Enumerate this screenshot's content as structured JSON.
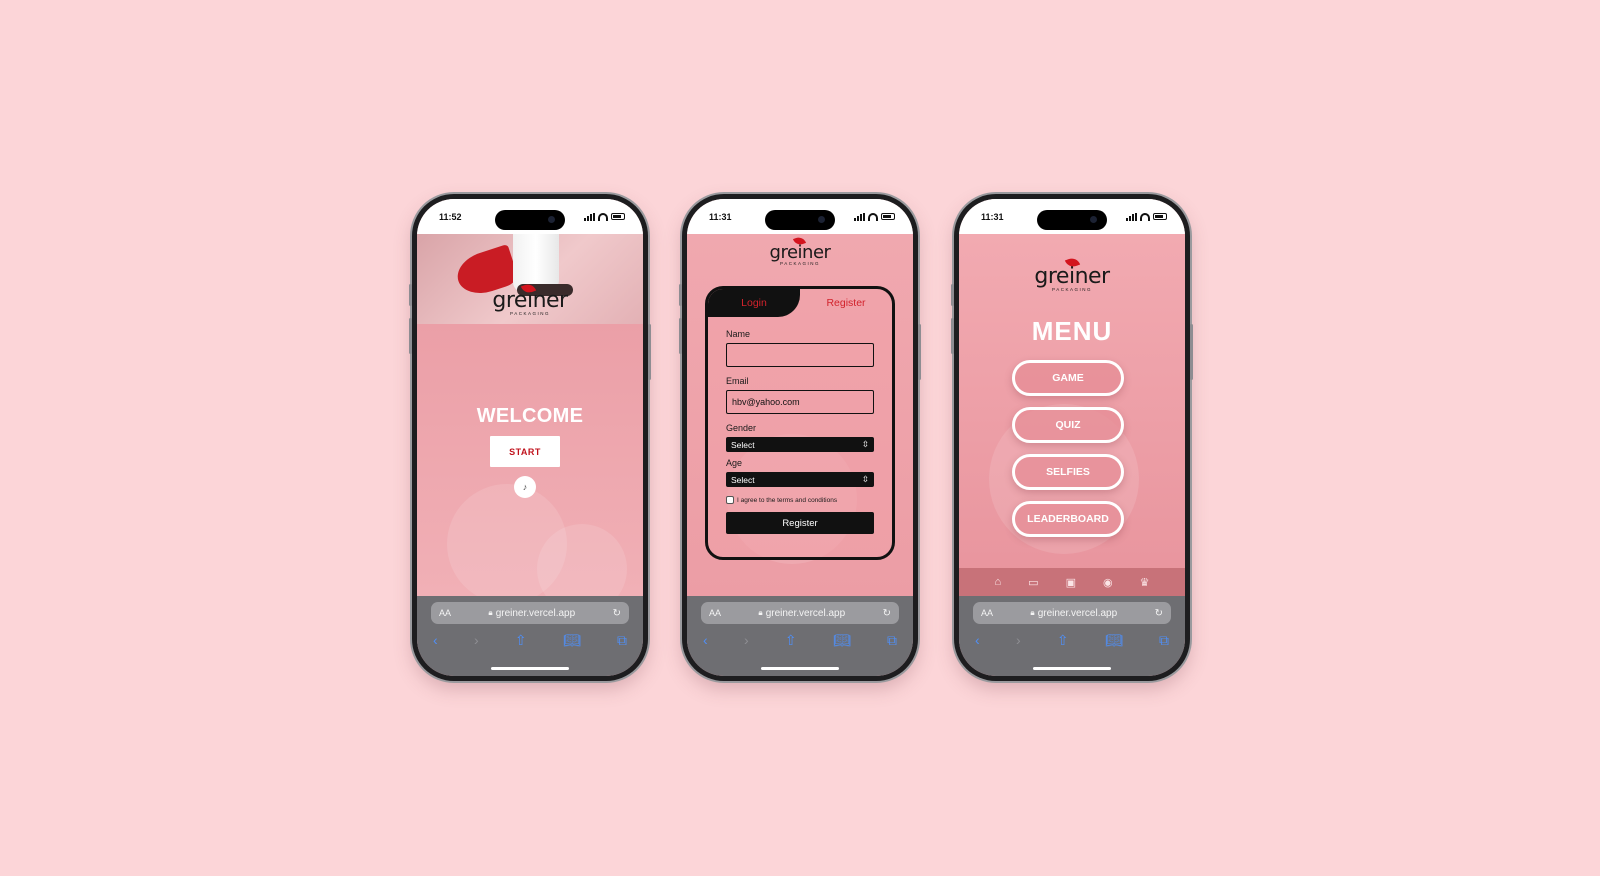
{
  "phones": [
    {
      "time": "11:52",
      "logo": {
        "word": "greiner",
        "tag": "PACKAGING"
      },
      "welcome": "WELCOME",
      "start_label": "START",
      "url": "greiner.vercel.app"
    },
    {
      "time": "11:31",
      "logo": {
        "word": "greiner",
        "tag": "PACKAGING"
      },
      "tabs": [
        "Login",
        "Register"
      ],
      "fields": {
        "name_label": "Name",
        "name_value": "",
        "email_label": "Email",
        "email_value": "hbv@yahoo.com",
        "gender_label": "Gender",
        "gender_value": "Select",
        "age_label": "Age",
        "age_value": "Select"
      },
      "agree_text": "I agree to the terms and conditions",
      "register_button": "Register",
      "url": "greiner.vercel.app"
    },
    {
      "time": "11:31",
      "logo": {
        "word": "greiner",
        "tag": "PACKAGING"
      },
      "menu_title": "MENU",
      "menu_items": [
        "GAME",
        "QUIZ",
        "SELFIES",
        "LEADERBOARD"
      ],
      "tabbar_icons": [
        "home-icon",
        "gamepad-icon",
        "quiz-icon",
        "camera-icon",
        "trophy-icon"
      ],
      "url": "greiner.vercel.app"
    }
  ],
  "browser": {
    "aa_label": "AA"
  },
  "colors": {
    "background": "#fcd5d8",
    "brand_red": "#d3141e",
    "screen_pink": "#eea3ab"
  }
}
